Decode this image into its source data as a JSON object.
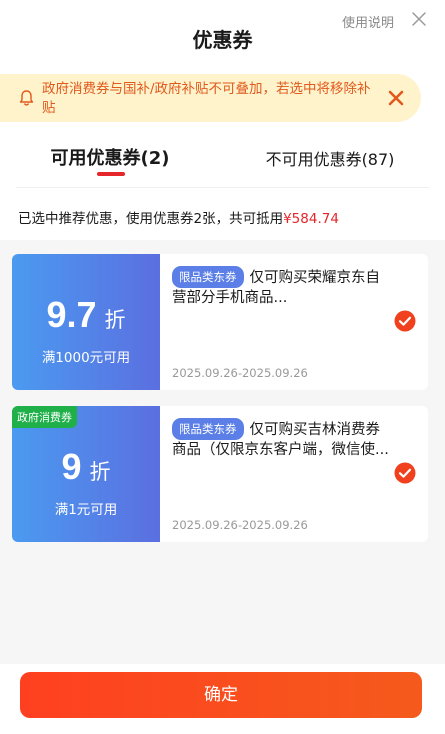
{
  "header": {
    "title": "优惠券",
    "help_label": "使用说明"
  },
  "notice": {
    "text": "政府消费券与国补/政府补贴不可叠加，若选中将移除补贴"
  },
  "tabs": [
    {
      "label": "可用优惠券(2)",
      "active": true
    },
    {
      "label": "不可用优惠券(87)",
      "active": false
    }
  ],
  "summary": {
    "text": "已选中推荐优惠，使用优惠券2张，共可抵用",
    "amount": "¥584.74"
  },
  "coupons": [
    {
      "discount": "9.7",
      "unit": "折",
      "condition": "满1000元可用",
      "tag": "限品类东券",
      "description": "仅可购买荣耀京东自营部分手机商品...",
      "date": "2025.09.26-2025.09.26",
      "selected": true
    },
    {
      "badge": "政府消费券",
      "discount": "9",
      "unit": "折",
      "condition": "满1元可用",
      "tag": "限品类东券",
      "description": "仅可购买吉林消费券商品（仅限京东客户端，微信使...",
      "date": "2025.09.26-2025.09.26",
      "selected": true
    }
  ],
  "footer": {
    "confirm_label": "确定"
  },
  "colors": {
    "accent": "#e5262a",
    "notice_bg": "#fff3cc",
    "notice_text": "#e0591d",
    "coupon_blue": "#5b6fe0",
    "gov_green": "#20b04a"
  },
  "icons": {
    "close": "close-icon",
    "bell": "bell-icon",
    "check": "check-circle-icon"
  }
}
